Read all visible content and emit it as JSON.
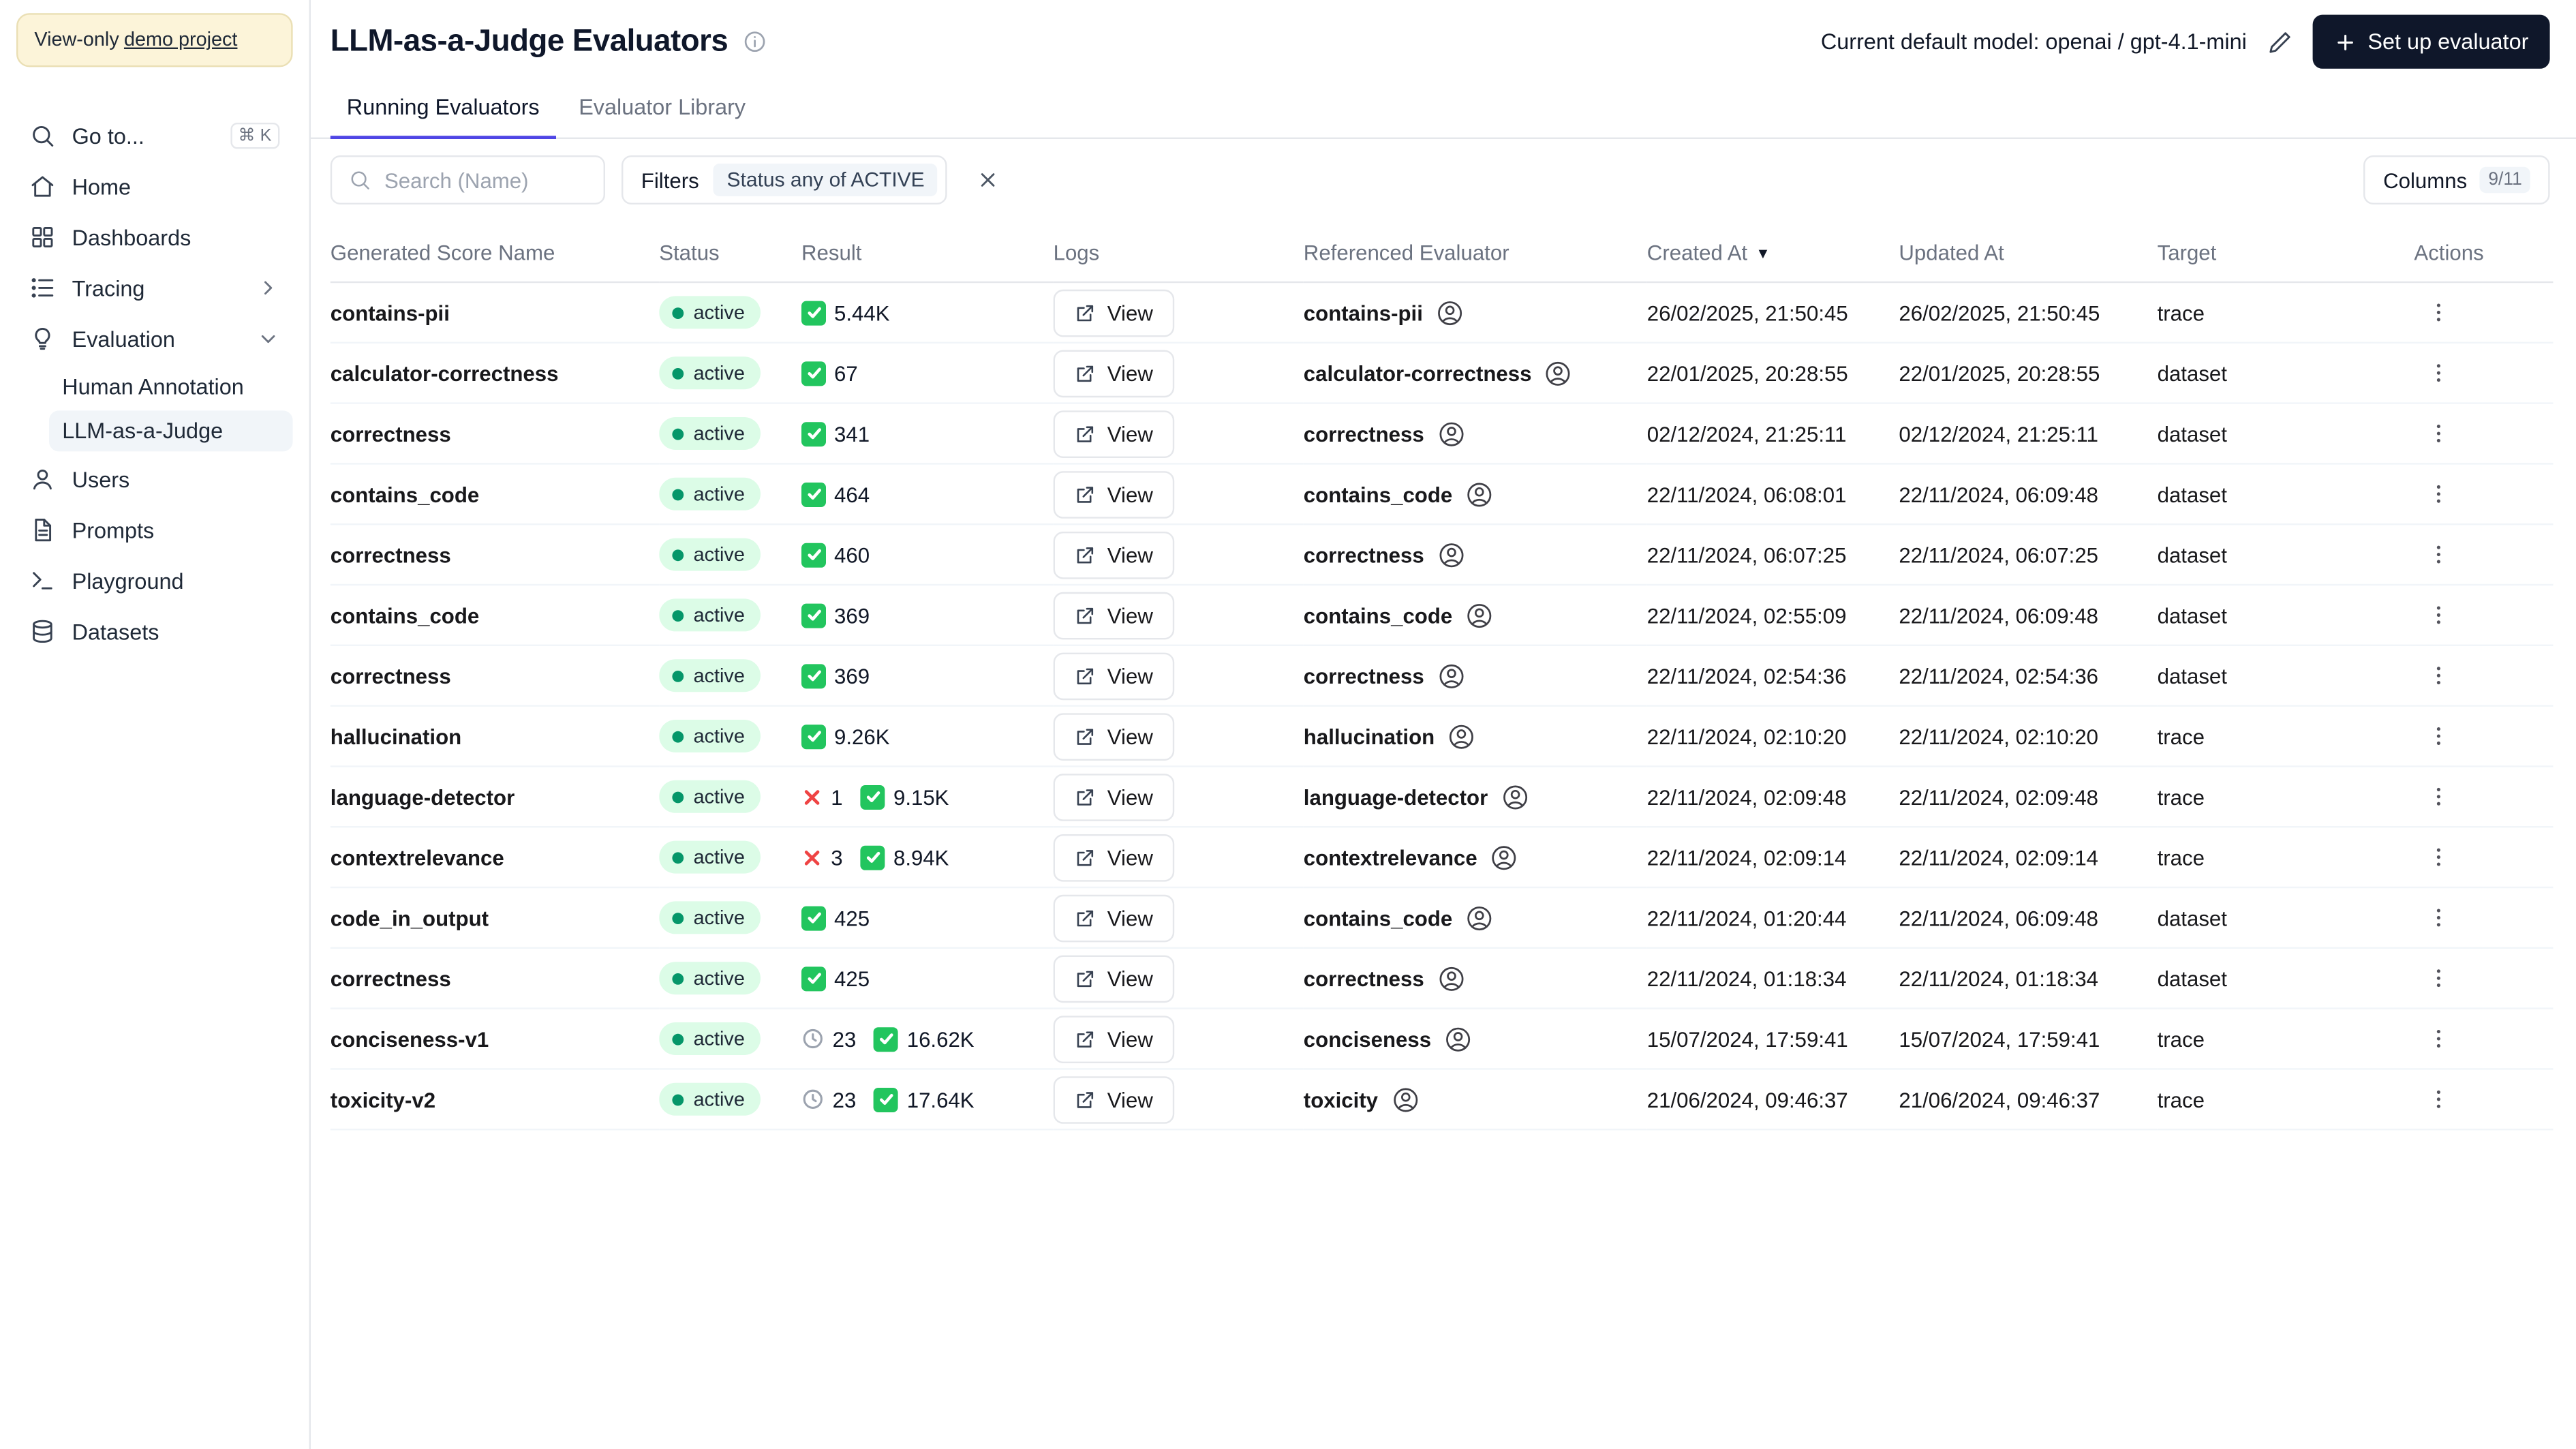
{
  "colors": {
    "accent": "#4f46e5",
    "status_active_bg": "#dcfce7",
    "status_active_dot": "#059669",
    "pass_green": "#22c55e",
    "fail_red": "#ef4444",
    "pending_gray": "#9ca3af",
    "button_dark": "#0f172a"
  },
  "banner": {
    "text": "View-only",
    "link": "demo project"
  },
  "sidebar": {
    "items": [
      {
        "label": "Go to...",
        "icon": "search",
        "shortcut": "⌘ K"
      },
      {
        "label": "Home",
        "icon": "home"
      },
      {
        "label": "Dashboards",
        "icon": "dashboards"
      },
      {
        "label": "Tracing",
        "icon": "tracing",
        "chevron": "right"
      },
      {
        "label": "Evaluation",
        "icon": "evaluation",
        "chevron": "down",
        "children": [
          {
            "label": "Human Annotation",
            "active": false
          },
          {
            "label": "LLM-as-a-Judge",
            "active": true
          }
        ]
      },
      {
        "label": "Users",
        "icon": "users"
      },
      {
        "label": "Prompts",
        "icon": "prompts"
      },
      {
        "label": "Playground",
        "icon": "playground"
      },
      {
        "label": "Datasets",
        "icon": "datasets"
      }
    ]
  },
  "header": {
    "title": "LLM-as-a-Judge Evaluators",
    "default_model": "Current default model: openai / gpt-4.1-mini",
    "setup_button": "Set up evaluator"
  },
  "tabs": [
    {
      "label": "Running Evaluators",
      "active": true
    },
    {
      "label": "Evaluator Library",
      "active": false
    }
  ],
  "toolbar": {
    "search_placeholder": "Search (Name)",
    "filters_label": "Filters",
    "filters_badge": "Status any of ACTIVE",
    "columns_label": "Columns",
    "columns_count": "9/11"
  },
  "table": {
    "columns": [
      "Generated Score Name",
      "Status",
      "Result",
      "Logs",
      "Referenced Evaluator",
      "Created At",
      "Updated At",
      "Target",
      "Actions"
    ],
    "sorted_by": "Created At",
    "sort_direction": "desc",
    "view_label": "View",
    "rows": [
      {
        "name": "contains-pii",
        "status": "active",
        "results": [
          {
            "type": "pass",
            "count": "5.44K"
          }
        ],
        "evaluator": "contains-pii",
        "created": "26/02/2025, 21:50:45",
        "updated": "26/02/2025, 21:50:45",
        "target": "trace"
      },
      {
        "name": "calculator-correctness",
        "status": "active",
        "results": [
          {
            "type": "pass",
            "count": "67"
          }
        ],
        "evaluator": "calculator-correctness",
        "created": "22/01/2025, 20:28:55",
        "updated": "22/01/2025, 20:28:55",
        "target": "dataset"
      },
      {
        "name": "correctness",
        "status": "active",
        "results": [
          {
            "type": "pass",
            "count": "341"
          }
        ],
        "evaluator": "correctness",
        "created": "02/12/2024, 21:25:11",
        "updated": "02/12/2024, 21:25:11",
        "target": "dataset"
      },
      {
        "name": "contains_code",
        "status": "active",
        "results": [
          {
            "type": "pass",
            "count": "464"
          }
        ],
        "evaluator": "contains_code",
        "created": "22/11/2024, 06:08:01",
        "updated": "22/11/2024, 06:09:48",
        "target": "dataset"
      },
      {
        "name": "correctness",
        "status": "active",
        "results": [
          {
            "type": "pass",
            "count": "460"
          }
        ],
        "evaluator": "correctness",
        "created": "22/11/2024, 06:07:25",
        "updated": "22/11/2024, 06:07:25",
        "target": "dataset"
      },
      {
        "name": "contains_code",
        "status": "active",
        "results": [
          {
            "type": "pass",
            "count": "369"
          }
        ],
        "evaluator": "contains_code",
        "created": "22/11/2024, 02:55:09",
        "updated": "22/11/2024, 06:09:48",
        "target": "dataset"
      },
      {
        "name": "correctness",
        "status": "active",
        "results": [
          {
            "type": "pass",
            "count": "369"
          }
        ],
        "evaluator": "correctness",
        "created": "22/11/2024, 02:54:36",
        "updated": "22/11/2024, 02:54:36",
        "target": "dataset"
      },
      {
        "name": "hallucination",
        "status": "active",
        "results": [
          {
            "type": "pass",
            "count": "9.26K"
          }
        ],
        "evaluator": "hallucination",
        "created": "22/11/2024, 02:10:20",
        "updated": "22/11/2024, 02:10:20",
        "target": "trace"
      },
      {
        "name": "language-detector",
        "status": "active",
        "results": [
          {
            "type": "fail",
            "count": "1"
          },
          {
            "type": "pass",
            "count": "9.15K"
          }
        ],
        "evaluator": "language-detector",
        "created": "22/11/2024, 02:09:48",
        "updated": "22/11/2024, 02:09:48",
        "target": "trace"
      },
      {
        "name": "contextrelevance",
        "status": "active",
        "results": [
          {
            "type": "fail",
            "count": "3"
          },
          {
            "type": "pass",
            "count": "8.94K"
          }
        ],
        "evaluator": "contextrelevance",
        "created": "22/11/2024, 02:09:14",
        "updated": "22/11/2024, 02:09:14",
        "target": "trace"
      },
      {
        "name": "code_in_output",
        "status": "active",
        "results": [
          {
            "type": "pass",
            "count": "425"
          }
        ],
        "evaluator": "contains_code",
        "created": "22/11/2024, 01:20:44",
        "updated": "22/11/2024, 06:09:48",
        "target": "dataset"
      },
      {
        "name": "correctness",
        "status": "active",
        "results": [
          {
            "type": "pass",
            "count": "425"
          }
        ],
        "evaluator": "correctness",
        "created": "22/11/2024, 01:18:34",
        "updated": "22/11/2024, 01:18:34",
        "target": "dataset"
      },
      {
        "name": "conciseness-v1",
        "status": "active",
        "results": [
          {
            "type": "pending",
            "count": "23"
          },
          {
            "type": "pass",
            "count": "16.62K"
          }
        ],
        "evaluator": "conciseness",
        "created": "15/07/2024, 17:59:41",
        "updated": "15/07/2024, 17:59:41",
        "target": "trace"
      },
      {
        "name": "toxicity-v2",
        "status": "active",
        "results": [
          {
            "type": "pending",
            "count": "23"
          },
          {
            "type": "pass",
            "count": "17.64K"
          }
        ],
        "evaluator": "toxicity",
        "created": "21/06/2024, 09:46:37",
        "updated": "21/06/2024, 09:46:37",
        "target": "trace"
      }
    ]
  }
}
